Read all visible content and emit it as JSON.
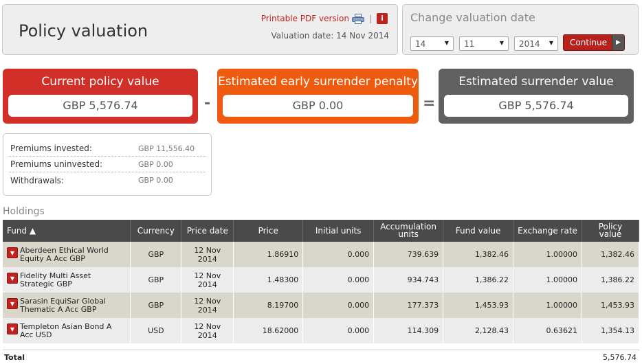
{
  "header": {
    "title": "Policy valuation",
    "pdf_link": "Printable PDF version",
    "separator": "|",
    "info_icon": "i",
    "valuation_date": "Valuation date: 14 Nov 2014"
  },
  "date_panel": {
    "title": "Change valuation date",
    "day": "14",
    "month": "11",
    "year": "2014",
    "continue_label": "Continue"
  },
  "values": {
    "current": {
      "label": "Current policy value",
      "value": "GBP 5,576.74"
    },
    "penalty": {
      "label": "Estimated early surrender penalty",
      "value": "GBP 0.00"
    },
    "surrender": {
      "label": "Estimated surrender value",
      "value": "GBP 5,576.74"
    },
    "minus": "-",
    "equals": "="
  },
  "summary": [
    {
      "label": "Premiums invested:",
      "value": "GBP 11,556.40"
    },
    {
      "label": "Premiums uninvested:",
      "value": "GBP 0.00"
    },
    {
      "label": "Withdrawals:",
      "value": "GBP 0.00"
    }
  ],
  "holdings": {
    "title": "Holdings",
    "columns": [
      "Fund ▲",
      "Currency",
      "Price date",
      "Price",
      "Initial units",
      "Accumulation units",
      "Fund value",
      "Exchange rate",
      "Policy value"
    ],
    "rows": [
      {
        "fund": "Aberdeen Ethical World Equity A Acc GBP",
        "currency": "GBP",
        "price_date": "12 Nov 2014",
        "price": "1.86910",
        "initial_units": "0.000",
        "acc_units": "739.639",
        "fund_value": "1,382.46",
        "exchange_rate": "1.00000",
        "policy_value": "1,382.46"
      },
      {
        "fund": "Fidelity Multi Asset Strategic GBP",
        "currency": "GBP",
        "price_date": "12 Nov 2014",
        "price": "1.48300",
        "initial_units": "0.000",
        "acc_units": "934.743",
        "fund_value": "1,386.22",
        "exchange_rate": "1.00000",
        "policy_value": "1,386.22"
      },
      {
        "fund": "Sarasin EquiSar Global Thematic A Acc GBP",
        "currency": "GBP",
        "price_date": "12 Nov 2014",
        "price": "8.19700",
        "initial_units": "0.000",
        "acc_units": "177.373",
        "fund_value": "1,453.93",
        "exchange_rate": "1.00000",
        "policy_value": "1,453.93"
      },
      {
        "fund": "Templeton Asian Bond A Acc USD",
        "currency": "USD",
        "price_date": "12 Nov 2014",
        "price": "18.62000",
        "initial_units": "0.000",
        "acc_units": "114.309",
        "fund_value": "2,128.43",
        "exchange_rate": "0.63621",
        "policy_value": "1,354.13"
      }
    ],
    "total_label": "Total",
    "total_value": "5,576.74"
  }
}
